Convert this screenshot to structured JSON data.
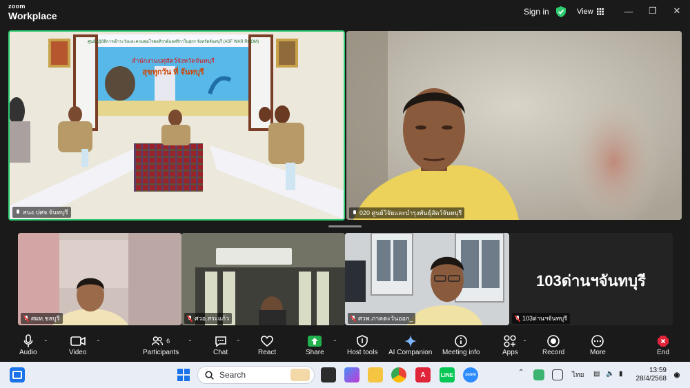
{
  "app": {
    "brand_top": "zoom",
    "brand_bottom": "Workplace"
  },
  "titlebar": {
    "signin": "Sign in",
    "view": "View",
    "shield_color": "#2ecc71"
  },
  "tiles": [
    {
      "name": "สนง.ปศจ.จันทบุรี",
      "mic": "on",
      "active": true
    },
    {
      "name": "020 ศูนย์วิจัยและบำรุงพันธุ์สัตว์จันทบุรี",
      "mic": "on",
      "active": false
    },
    {
      "name": "ศผท.ชลบุรี",
      "mic": "muted"
    },
    {
      "name": "ศวอ.สระแก้ว",
      "mic": "muted"
    },
    {
      "name": "ศวพ.ภาคตะวันออก_",
      "mic": "muted"
    },
    {
      "name": "103ด่านฯจันทบุรี",
      "mic": "muted",
      "placeholder": "103ด่านฯจันทบุรี"
    }
  ],
  "banner": {
    "top": "ศูนย์ปฏิบัติการเฝ้าระวังและควบคุมโรคอหิวาต์แอฟริกาในสุกร จังหวัดจันทบุรี (ASF WAR ROOM)",
    "slogan_line1": "สำนักงานปศุสัตว์จังหวัดจันทบุรี",
    "slogan_line2": "สุขทุกวัน ที่ จันทบุรี"
  },
  "toolbar": {
    "audio": "Audio",
    "video": "Video",
    "participants": "Participants",
    "participants_count": "6",
    "chat": "Chat",
    "react": "React",
    "share": "Share",
    "host_tools": "Host tools",
    "ai_companion": "AI Companion",
    "meeting_info": "Meeting info",
    "apps": "Apps",
    "record": "Record",
    "more": "More",
    "end": "End"
  },
  "taskbar": {
    "search_placeholder": "Search",
    "lang": "ไทย",
    "time": "13:59",
    "date": "28/4/2568"
  },
  "colors": {
    "active_border": "#2ecc71",
    "share_green": "#22b14c",
    "end_red": "#e0243a"
  }
}
